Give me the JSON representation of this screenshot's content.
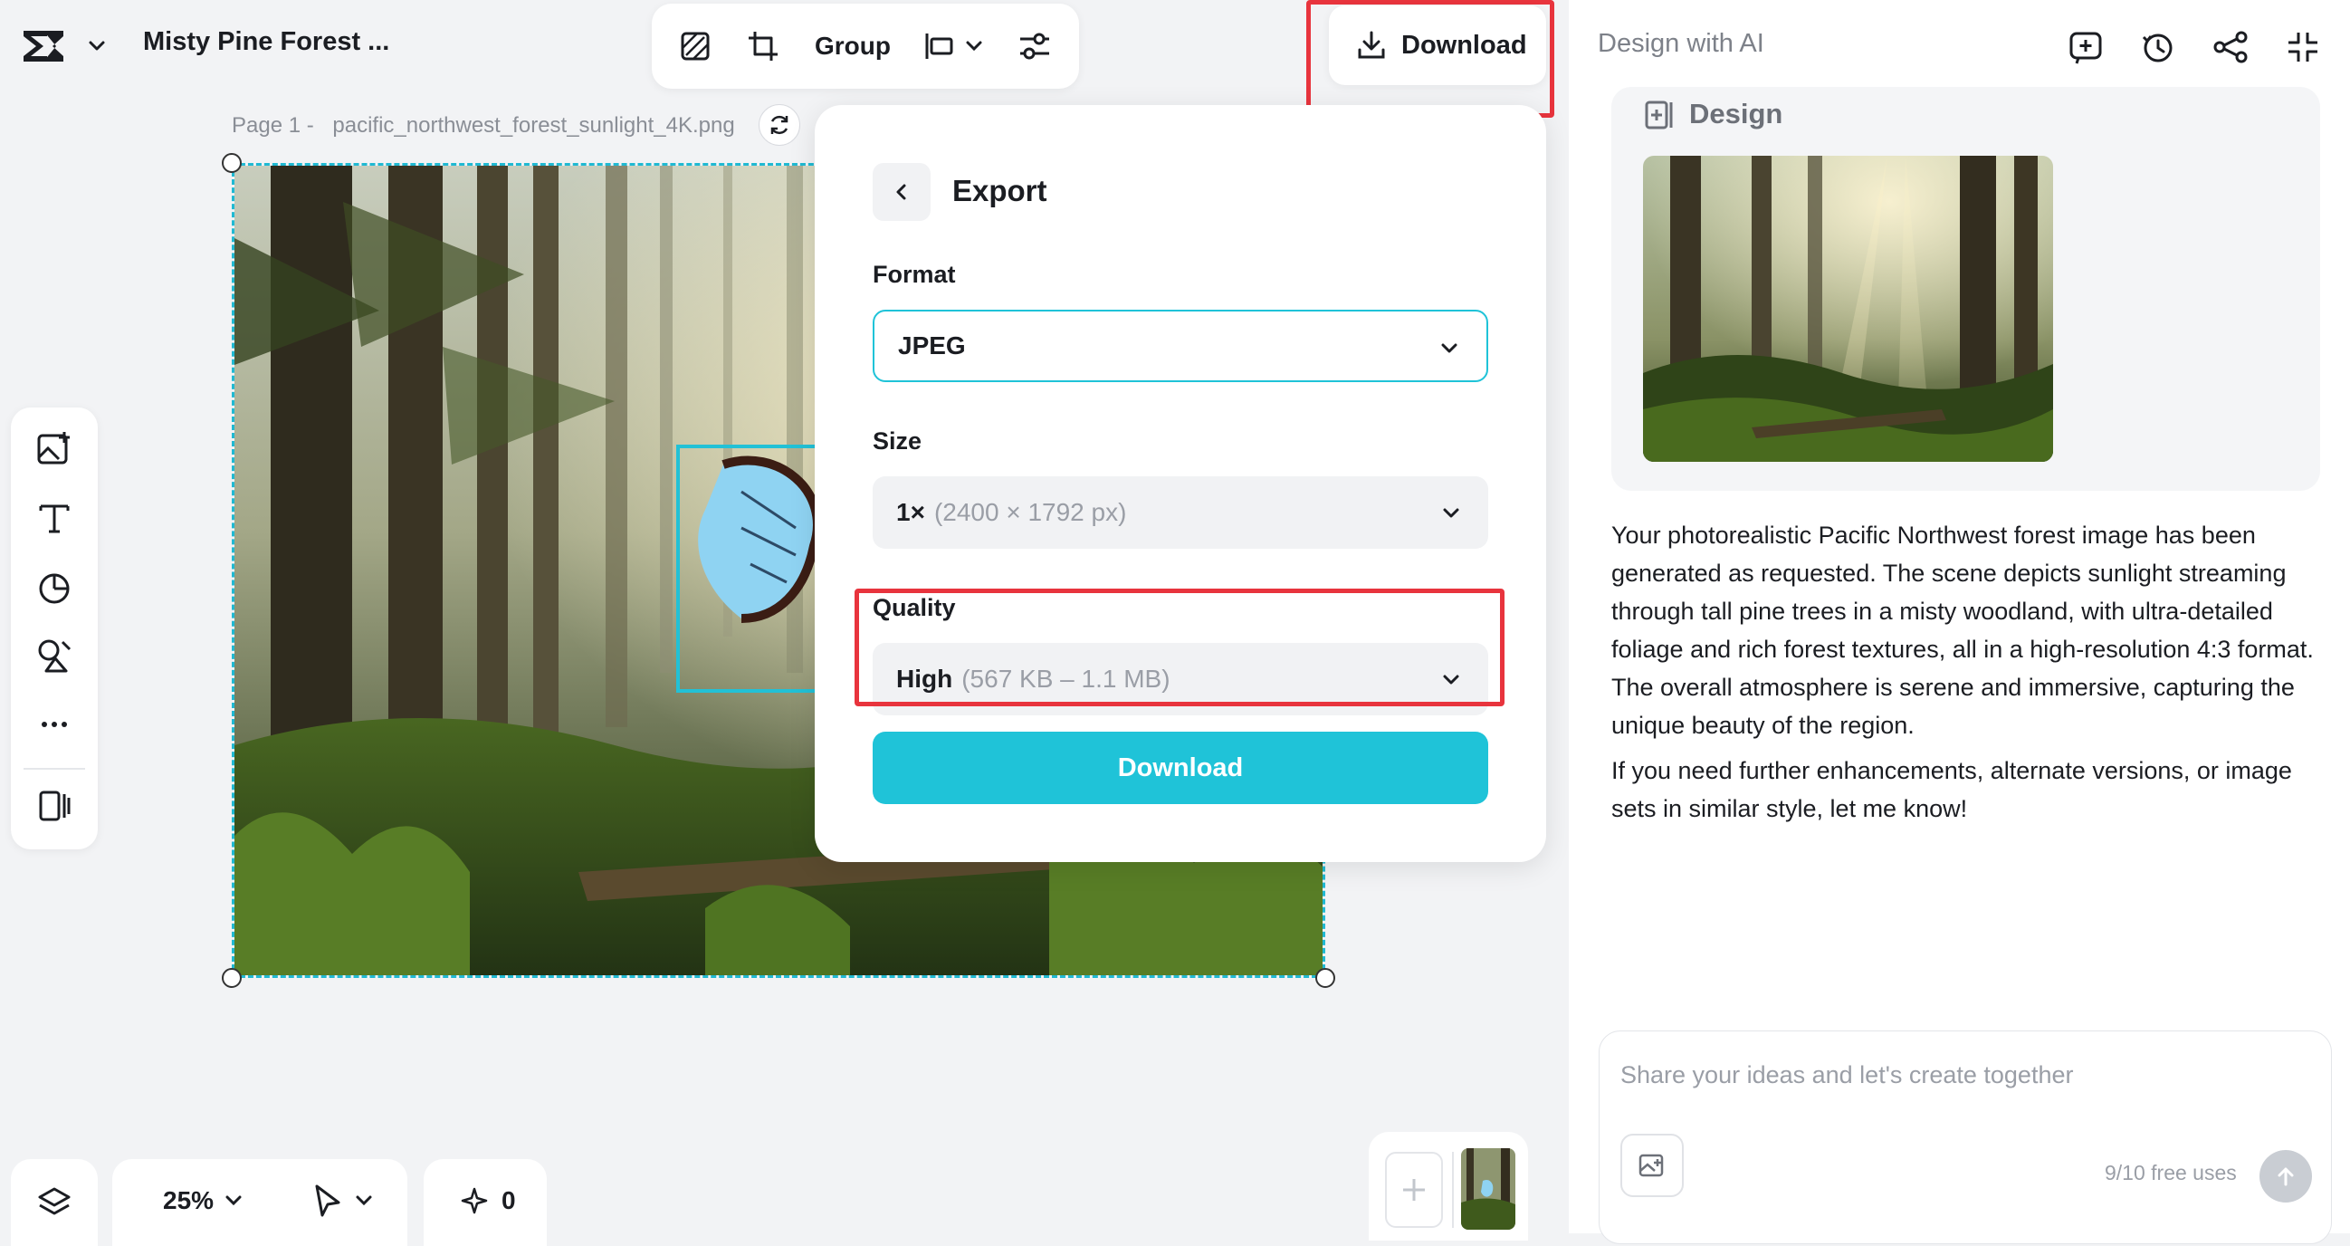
{
  "header": {
    "project_title": "Misty Pine Forest ...",
    "group_label": "Group",
    "download_label": "Download"
  },
  "right_panel": {
    "title": "Design with AI",
    "design_label": "Design",
    "message_paragraph_1": "Your photorealistic Pacific Northwest forest image has been generated as requested. The scene depicts sunlight streaming through tall pine trees in a misty woodland, with ultra-detailed foliage and rich forest textures, all in a high-resolution 4:3 format. The overall atmosphere is serene and immersive, capturing the unique beauty of the region.",
    "message_paragraph_2": "If you need further enhancements, alternate versions, or image sets in similar style, let me know!",
    "composer_placeholder": "Share your ideas and let's create together",
    "free_uses": "9/10 free uses"
  },
  "canvas": {
    "page_prefix": "Page 1 -",
    "file_name": "pacific_northwest_forest_sunlight_4K.png"
  },
  "export_panel": {
    "title": "Export",
    "format_label": "Format",
    "format_value": "JPEG",
    "size_label": "Size",
    "size_main": "1×",
    "size_detail": "(2400 × 1792 px)",
    "quality_label": "Quality",
    "quality_main": "High",
    "quality_detail": "(567 KB – 1.1 MB)",
    "download_button": "Download"
  },
  "bottom_bar": {
    "zoom": "25%",
    "ai_count": "0"
  },
  "colors": {
    "accent": "#1fc3d8",
    "highlight": "#e8343d"
  },
  "icons": {
    "left_tools": [
      "image-add-icon",
      "text-icon",
      "shapes-icon",
      "elements-icon",
      "more-icon",
      "panel-icon"
    ]
  }
}
